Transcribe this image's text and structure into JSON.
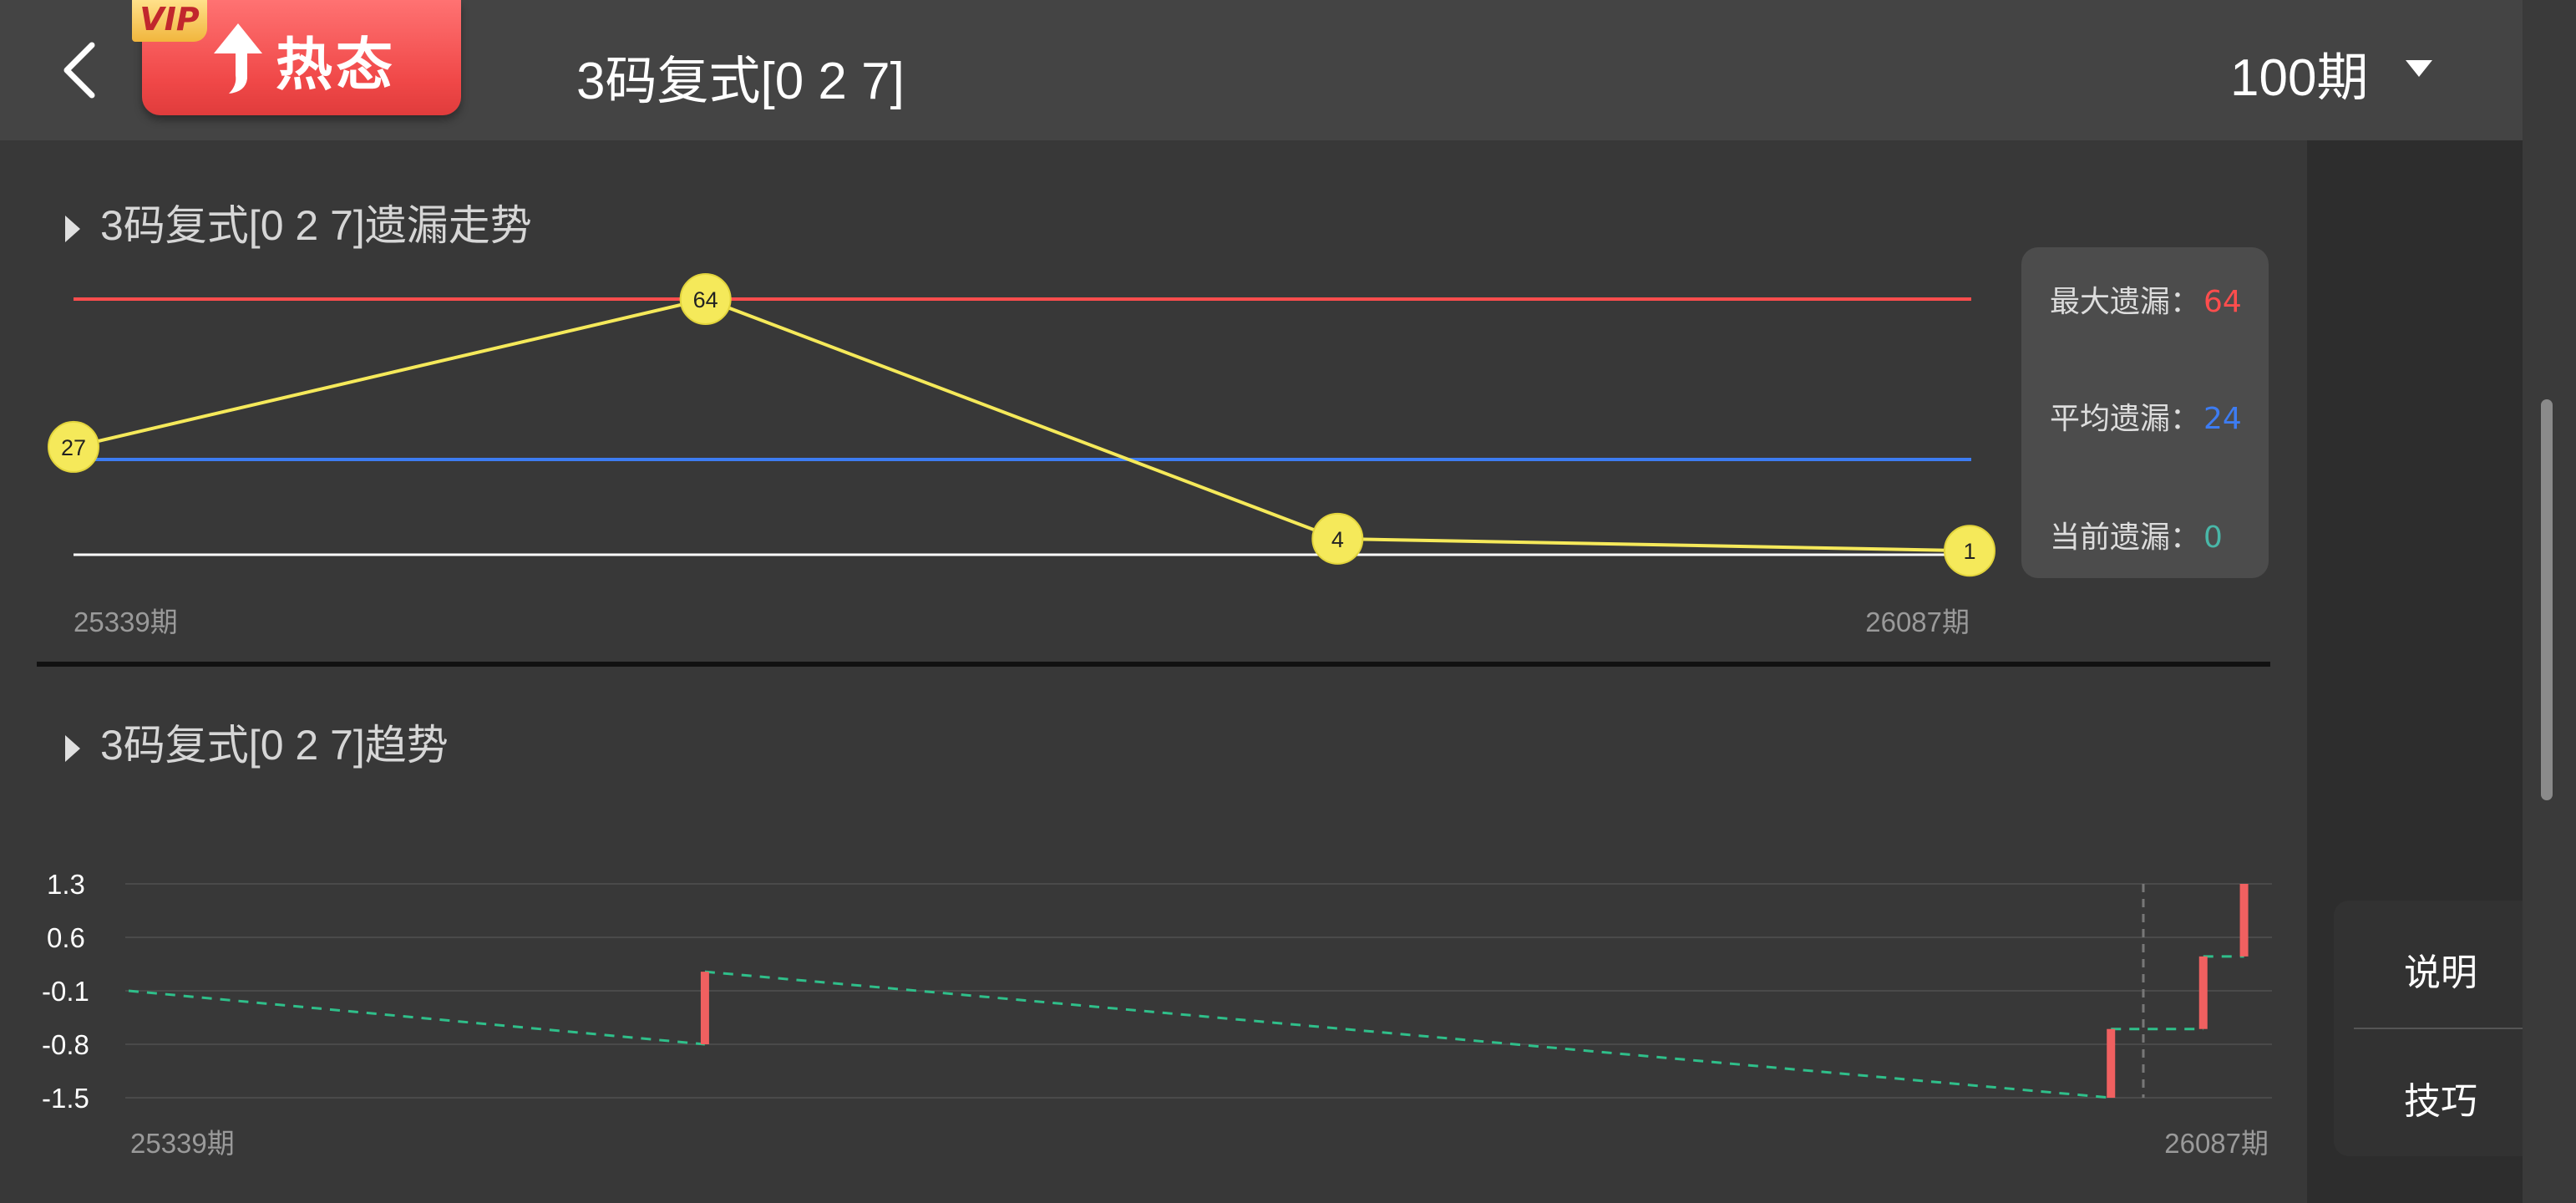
{
  "header": {
    "vip_label": "VIP",
    "hot_label": "热态",
    "title": "3码复式[0 2 7]",
    "period_value": "100期",
    "icons": {
      "back": "back-chevron-icon",
      "arrow": "up-arrow-icon",
      "dropdown": "caret-down-icon"
    }
  },
  "omission_chart": {
    "title": "3码复式[0 2 7]遗漏走势",
    "stats": {
      "max_label": "最大遗漏：",
      "max_value": "64",
      "avg_label": "平均遗漏：",
      "avg_value": "24",
      "cur_label": "当前遗漏：",
      "cur_value": "0"
    },
    "colors": {
      "max": "#ff4d4d",
      "avg": "#3d7cf2",
      "cur": "#49b7a8",
      "line": "#f5e95a"
    }
  },
  "trend_chart": {
    "title": "3码复式[0 2 7]趋势"
  },
  "side_menu": {
    "explain_label": "说明",
    "tips_label": "技巧"
  },
  "chart_data": [
    {
      "type": "line",
      "title": "3码复式[0 2 7]遗漏走势",
      "x_start_label": "25339期",
      "x_end_label": "26087期",
      "series": [
        {
          "values": [
            27,
            64,
            4,
            1
          ]
        }
      ],
      "reference_lines": [
        {
          "name": "最大遗漏",
          "value": 64,
          "color": "#ff4d4d"
        },
        {
          "name": "平均遗漏",
          "value": 24,
          "color": "#3d7cf2"
        },
        {
          "name": "当前遗漏",
          "value": 0,
          "color": "#ffffff"
        }
      ],
      "ylim": [
        0,
        64
      ]
    },
    {
      "type": "bar",
      "title": "3码复式[0 2 7]趋势",
      "y_ticks": [
        "1.3",
        "0.6",
        "-0.1",
        "-0.8",
        "-1.5"
      ],
      "ylim": [
        -1.5,
        1.3
      ],
      "x_start_label": "25339期",
      "x_end_label": "26087期",
      "bars": [
        {
          "x": 0.27,
          "low": -0.8,
          "high": 0.15
        },
        {
          "x": 0.925,
          "low": -1.5,
          "high": -0.6
        },
        {
          "x": 0.968,
          "low": -0.6,
          "high": 0.35
        },
        {
          "x": 0.987,
          "low": 0.35,
          "high": 1.3
        }
      ],
      "trend_line_color": "#2fbf8a",
      "bar_color": "#f06060",
      "grid": true
    }
  ]
}
